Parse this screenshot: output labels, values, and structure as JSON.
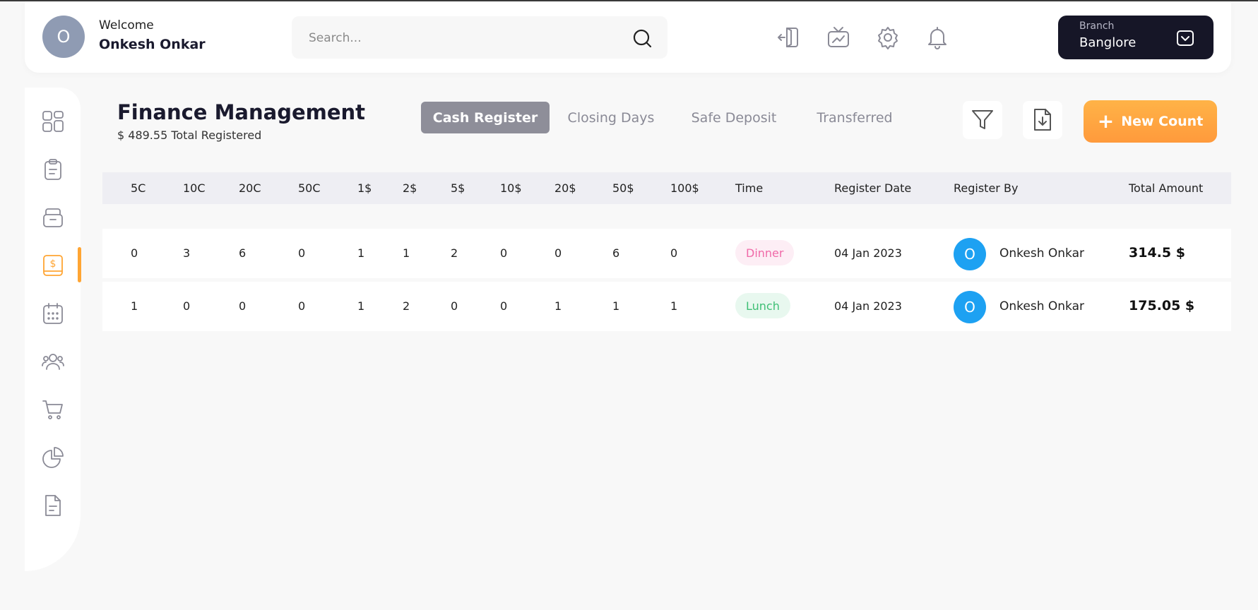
{
  "header": {
    "avatar_initial": "O",
    "welcome": "Welcome",
    "username": "Onkesh Onkar",
    "search_placeholder": "Search...",
    "icons": [
      "logout-icon",
      "tv-icon",
      "settings-icon",
      "bell-icon"
    ],
    "branch": {
      "label": "Branch",
      "value": "Banglore"
    }
  },
  "sidebar": {
    "items": [
      "dashboard-icon",
      "clipboard-icon",
      "archive-icon",
      "finance-icon",
      "calendar-icon",
      "users-icon",
      "cart-icon",
      "pie-chart-icon",
      "document-icon"
    ],
    "active_index": 3,
    "accent": "#ffa533"
  },
  "page": {
    "title": "Finance Management",
    "subtitle": "$ 489.55 Total Registered",
    "tabs": [
      "Cash Register",
      "Closing Days",
      "Safe Deposit",
      "Transferred"
    ],
    "active_tab": 0,
    "new_count_label": "New Count"
  },
  "table": {
    "columns": [
      "5C",
      "10C",
      "20C",
      "50C",
      "1$",
      "2$",
      "5$",
      "10$",
      "20$",
      "50$",
      "100$",
      "Time",
      "Register Date",
      "Register By",
      "Total Amount"
    ],
    "rows": [
      {
        "counts": [
          "0",
          "3",
          "6",
          "0",
          "1",
          "1",
          "2",
          "0",
          "0",
          "6",
          "0"
        ],
        "time": "Dinner",
        "date": "04 Jan 2023",
        "avatar": "O",
        "by": "Onkesh Onkar",
        "total": "314.5 $"
      },
      {
        "counts": [
          "1",
          "0",
          "0",
          "0",
          "1",
          "2",
          "0",
          "0",
          "1",
          "1",
          "1"
        ],
        "time": "Lunch",
        "date": "04 Jan 2023",
        "avatar": "O",
        "by": "Onkesh Onkar",
        "total": "175.05 $"
      }
    ]
  }
}
